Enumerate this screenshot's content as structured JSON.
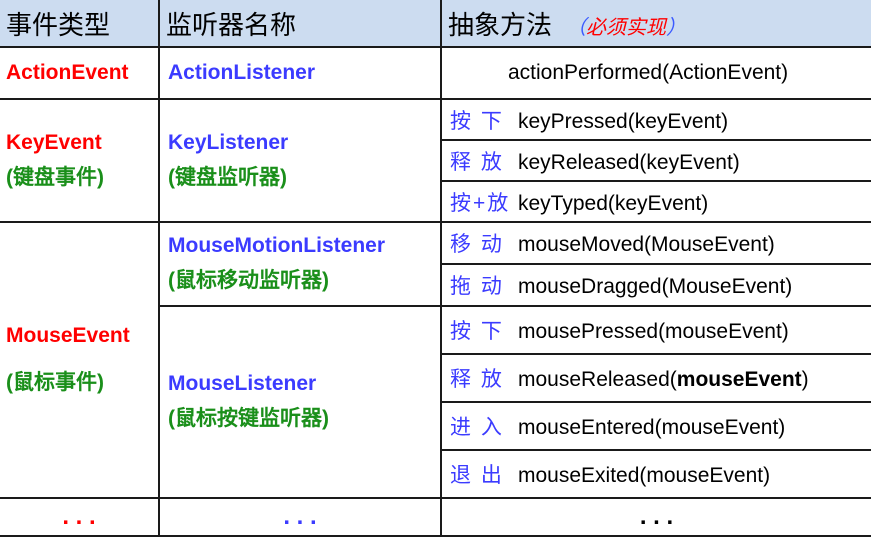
{
  "header": {
    "col1": "事件类型",
    "col2": "监听器名称",
    "col3": "抽象方法",
    "required": "必须实现",
    "paren_open": "（",
    "paren_close": "）"
  },
  "rows": {
    "action": {
      "event": "ActionEvent",
      "listener": "ActionListener",
      "method": "actionPerformed(ActionEvent)"
    },
    "key": {
      "event": "KeyEvent",
      "event_cn": "(键盘事件)",
      "listener": "KeyListener",
      "listener_cn": "(键盘监听器)",
      "methods": [
        {
          "op": "按 下",
          "sig": "keyPressed(keyEvent)"
        },
        {
          "op": "释 放",
          "sig": "keyReleased(keyEvent)"
        },
        {
          "op": "按+放",
          "sig": "keyTyped(keyEvent)"
        }
      ]
    },
    "mouse": {
      "event": "MouseEvent",
      "event_cn": "(鼠标事件)",
      "motion_listener": "MouseMotionListener",
      "motion_listener_cn": "(鼠标移动监听器)",
      "listener": "MouseListener",
      "listener_cn": "(鼠标按键监听器)",
      "motion_methods": [
        {
          "op": "移 动",
          "sig": "mouseMoved(MouseEvent)"
        },
        {
          "op": "拖 动",
          "sig": "mouseDragged(MouseEvent)"
        }
      ],
      "methods": [
        {
          "op": "按 下",
          "sig": "mousePressed(mouseEvent)"
        },
        {
          "op": "释 放",
          "sig_prefix": "mouseReleased(",
          "sig_bold": "mouseEvent",
          "sig_suffix": ")"
        },
        {
          "op": "进 入",
          "sig": "mouseEntered(mouseEvent)"
        },
        {
          "op": "退 出",
          "sig": "mouseExited(mouseEvent)"
        }
      ]
    },
    "more": {
      "col1": ". . .",
      "col2": ". . .",
      "col3": ". . ."
    }
  },
  "colors": {
    "header_bg": "#ccdcf0",
    "event_red": "#ff0000",
    "listener_blue": "#3b3bff",
    "cn_green": "#1a8f1a"
  }
}
